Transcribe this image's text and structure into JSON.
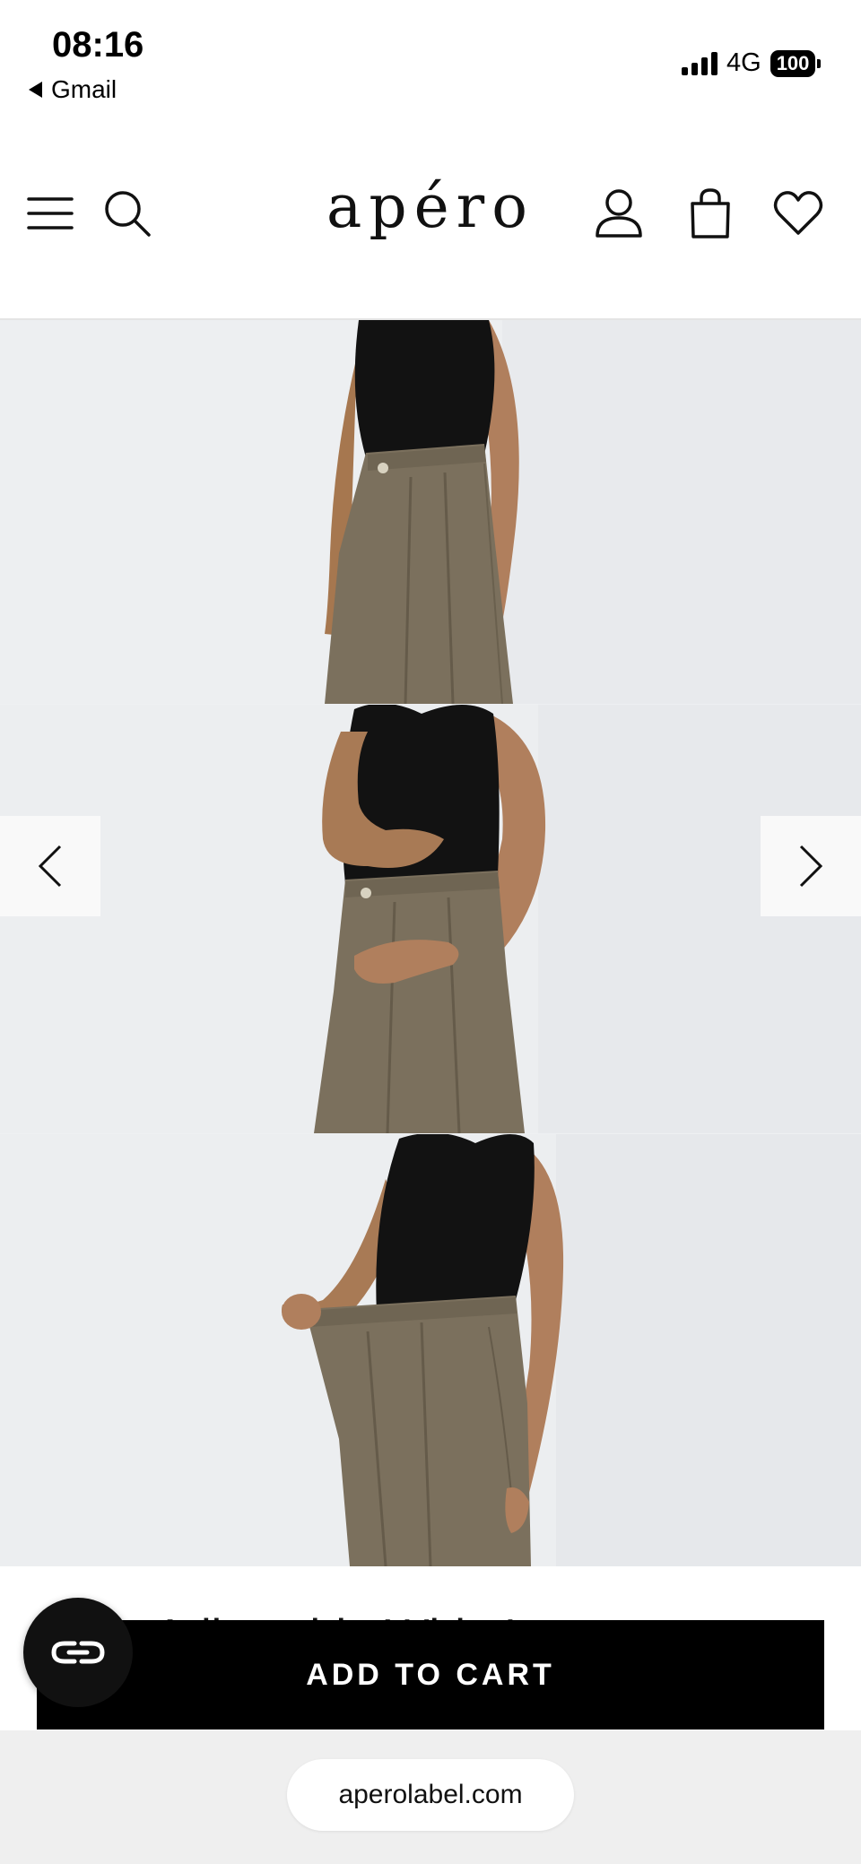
{
  "status_bar": {
    "time": "08:16",
    "back_label": "Gmail",
    "network": "4G",
    "battery": "100"
  },
  "header": {
    "logo": "apéro",
    "icons": [
      "menu-icon",
      "search-icon",
      "account-icon",
      "shopping-bag-icon",
      "heart-icon"
    ]
  },
  "gallery": {
    "prev_icon": "chevron-left-icon",
    "next_icon": "chevron-right-icon"
  },
  "product": {
    "title": "Tallie Adjustable Wide Leg"
  },
  "cart": {
    "add_label": "ADD TO CART"
  },
  "chat": {
    "icon": "chat-icon"
  },
  "browser": {
    "url": "aperolabel.com"
  },
  "colors": {
    "accent": "#000000",
    "pants": "#7b705d",
    "top": "#111111",
    "skin": "#b07f5d",
    "backdrop": "#edeff1"
  }
}
